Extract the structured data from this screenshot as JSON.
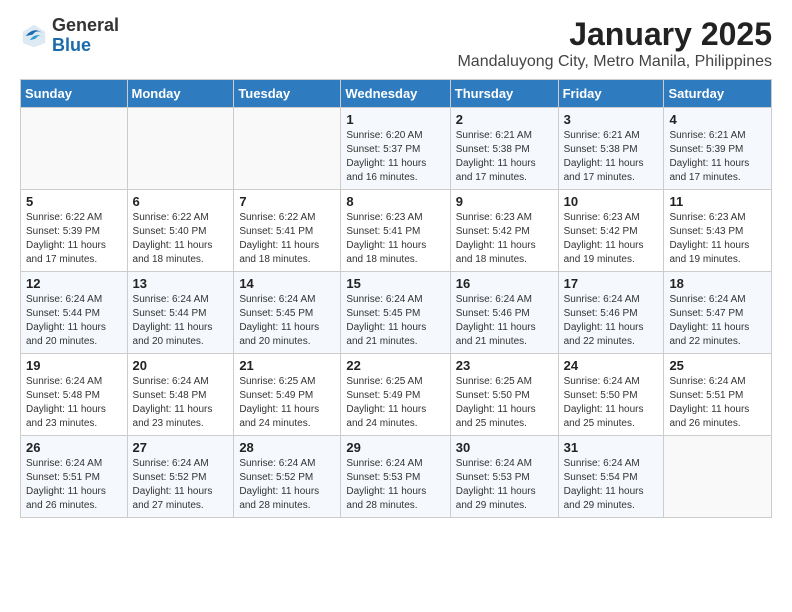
{
  "header": {
    "logo_general": "General",
    "logo_blue": "Blue",
    "main_title": "January 2025",
    "subtitle": "Mandaluyong City, Metro Manila, Philippines"
  },
  "days_of_week": [
    "Sunday",
    "Monday",
    "Tuesday",
    "Wednesday",
    "Thursday",
    "Friday",
    "Saturday"
  ],
  "weeks": [
    [
      {
        "day": "",
        "info": ""
      },
      {
        "day": "",
        "info": ""
      },
      {
        "day": "",
        "info": ""
      },
      {
        "day": "1",
        "info": "Sunrise: 6:20 AM\nSunset: 5:37 PM\nDaylight: 11 hours and 16 minutes."
      },
      {
        "day": "2",
        "info": "Sunrise: 6:21 AM\nSunset: 5:38 PM\nDaylight: 11 hours and 17 minutes."
      },
      {
        "day": "3",
        "info": "Sunrise: 6:21 AM\nSunset: 5:38 PM\nDaylight: 11 hours and 17 minutes."
      },
      {
        "day": "4",
        "info": "Sunrise: 6:21 AM\nSunset: 5:39 PM\nDaylight: 11 hours and 17 minutes."
      }
    ],
    [
      {
        "day": "5",
        "info": "Sunrise: 6:22 AM\nSunset: 5:39 PM\nDaylight: 11 hours and 17 minutes."
      },
      {
        "day": "6",
        "info": "Sunrise: 6:22 AM\nSunset: 5:40 PM\nDaylight: 11 hours and 18 minutes."
      },
      {
        "day": "7",
        "info": "Sunrise: 6:22 AM\nSunset: 5:41 PM\nDaylight: 11 hours and 18 minutes."
      },
      {
        "day": "8",
        "info": "Sunrise: 6:23 AM\nSunset: 5:41 PM\nDaylight: 11 hours and 18 minutes."
      },
      {
        "day": "9",
        "info": "Sunrise: 6:23 AM\nSunset: 5:42 PM\nDaylight: 11 hours and 18 minutes."
      },
      {
        "day": "10",
        "info": "Sunrise: 6:23 AM\nSunset: 5:42 PM\nDaylight: 11 hours and 19 minutes."
      },
      {
        "day": "11",
        "info": "Sunrise: 6:23 AM\nSunset: 5:43 PM\nDaylight: 11 hours and 19 minutes."
      }
    ],
    [
      {
        "day": "12",
        "info": "Sunrise: 6:24 AM\nSunset: 5:44 PM\nDaylight: 11 hours and 20 minutes."
      },
      {
        "day": "13",
        "info": "Sunrise: 6:24 AM\nSunset: 5:44 PM\nDaylight: 11 hours and 20 minutes."
      },
      {
        "day": "14",
        "info": "Sunrise: 6:24 AM\nSunset: 5:45 PM\nDaylight: 11 hours and 20 minutes."
      },
      {
        "day": "15",
        "info": "Sunrise: 6:24 AM\nSunset: 5:45 PM\nDaylight: 11 hours and 21 minutes."
      },
      {
        "day": "16",
        "info": "Sunrise: 6:24 AM\nSunset: 5:46 PM\nDaylight: 11 hours and 21 minutes."
      },
      {
        "day": "17",
        "info": "Sunrise: 6:24 AM\nSunset: 5:46 PM\nDaylight: 11 hours and 22 minutes."
      },
      {
        "day": "18",
        "info": "Sunrise: 6:24 AM\nSunset: 5:47 PM\nDaylight: 11 hours and 22 minutes."
      }
    ],
    [
      {
        "day": "19",
        "info": "Sunrise: 6:24 AM\nSunset: 5:48 PM\nDaylight: 11 hours and 23 minutes."
      },
      {
        "day": "20",
        "info": "Sunrise: 6:24 AM\nSunset: 5:48 PM\nDaylight: 11 hours and 23 minutes."
      },
      {
        "day": "21",
        "info": "Sunrise: 6:25 AM\nSunset: 5:49 PM\nDaylight: 11 hours and 24 minutes."
      },
      {
        "day": "22",
        "info": "Sunrise: 6:25 AM\nSunset: 5:49 PM\nDaylight: 11 hours and 24 minutes."
      },
      {
        "day": "23",
        "info": "Sunrise: 6:25 AM\nSunset: 5:50 PM\nDaylight: 11 hours and 25 minutes."
      },
      {
        "day": "24",
        "info": "Sunrise: 6:24 AM\nSunset: 5:50 PM\nDaylight: 11 hours and 25 minutes."
      },
      {
        "day": "25",
        "info": "Sunrise: 6:24 AM\nSunset: 5:51 PM\nDaylight: 11 hours and 26 minutes."
      }
    ],
    [
      {
        "day": "26",
        "info": "Sunrise: 6:24 AM\nSunset: 5:51 PM\nDaylight: 11 hours and 26 minutes."
      },
      {
        "day": "27",
        "info": "Sunrise: 6:24 AM\nSunset: 5:52 PM\nDaylight: 11 hours and 27 minutes."
      },
      {
        "day": "28",
        "info": "Sunrise: 6:24 AM\nSunset: 5:52 PM\nDaylight: 11 hours and 28 minutes."
      },
      {
        "day": "29",
        "info": "Sunrise: 6:24 AM\nSunset: 5:53 PM\nDaylight: 11 hours and 28 minutes."
      },
      {
        "day": "30",
        "info": "Sunrise: 6:24 AM\nSunset: 5:53 PM\nDaylight: 11 hours and 29 minutes."
      },
      {
        "day": "31",
        "info": "Sunrise: 6:24 AM\nSunset: 5:54 PM\nDaylight: 11 hours and 29 minutes."
      },
      {
        "day": "",
        "info": ""
      }
    ]
  ]
}
